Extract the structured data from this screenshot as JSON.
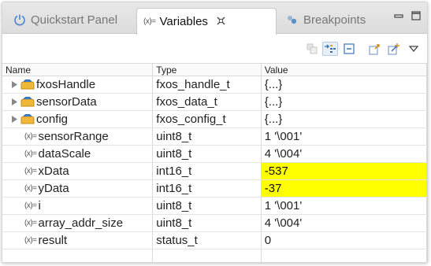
{
  "tabs": {
    "quickstart": "Quickstart Panel",
    "variables": "Variables",
    "variables_marker": "(x)=",
    "breakpoints": "Breakpoints"
  },
  "columns": {
    "name": "Name",
    "type": "Type",
    "value": "Value"
  },
  "variables": [
    {
      "name": "fxosHandle",
      "type": "fxos_handle_t",
      "value": "{...}",
      "kind": "struct",
      "expandable": true
    },
    {
      "name": "sensorData",
      "type": "fxos_data_t",
      "value": "{...}",
      "kind": "struct",
      "expandable": true
    },
    {
      "name": "config",
      "type": "fxos_config_t",
      "value": "{...}",
      "kind": "struct",
      "expandable": true
    },
    {
      "name": "sensorRange",
      "type": "uint8_t",
      "value": "1 '\\001'",
      "kind": "scalar"
    },
    {
      "name": "dataScale",
      "type": "uint8_t",
      "value": "4 '\\004'",
      "kind": "scalar"
    },
    {
      "name": "xData",
      "type": "int16_t",
      "value": "-537",
      "kind": "scalar",
      "changed": true
    },
    {
      "name": "yData",
      "type": "int16_t",
      "value": "-37",
      "kind": "scalar",
      "changed": true
    },
    {
      "name": "i",
      "type": "uint8_t",
      "value": "1 '\\001'",
      "kind": "scalar"
    },
    {
      "name": "array_addr_size",
      "type": "uint8_t",
      "value": "4 '\\004'",
      "kind": "scalar"
    },
    {
      "name": "result",
      "type": "status_t",
      "value": "0",
      "kind": "scalar"
    }
  ],
  "colors": {
    "changed_highlight": "#ffff00",
    "struct_icon": "#e8b030",
    "active_tab_bg": "#ffffff"
  }
}
